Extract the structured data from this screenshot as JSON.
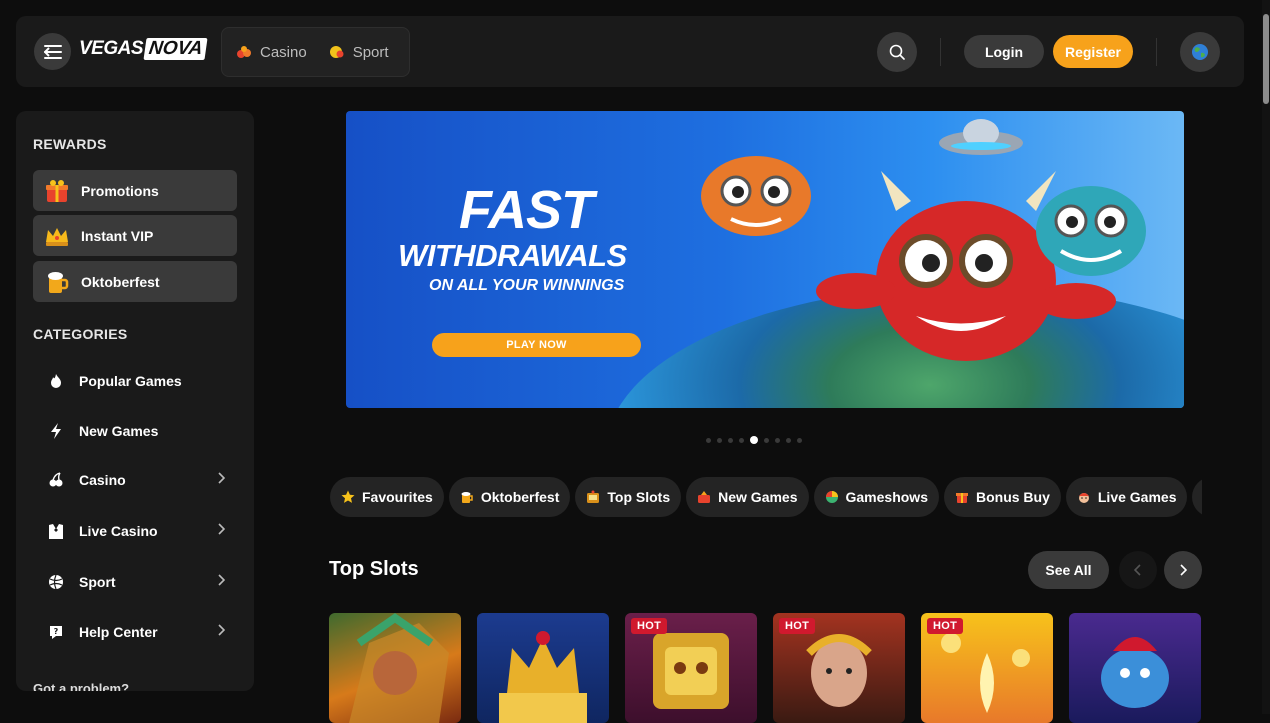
{
  "header": {
    "logo_part1": "VEGAS",
    "logo_part2": "NOVA",
    "nav": [
      {
        "label": "Casino",
        "icon": "casino-icon"
      },
      {
        "label": "Sport",
        "icon": "sport-icon"
      }
    ],
    "login_label": "Login",
    "register_label": "Register"
  },
  "sidebar": {
    "rewards_title": "REWARDS",
    "rewards": [
      {
        "label": "Promotions",
        "icon": "gift-icon"
      },
      {
        "label": "Instant VIP",
        "icon": "crown-icon"
      },
      {
        "label": "Oktoberfest",
        "icon": "beer-icon"
      }
    ],
    "categories_title": "CATEGORIES",
    "categories": [
      {
        "label": "Popular Games",
        "icon": "flame-icon",
        "chevron": false
      },
      {
        "label": "New Games",
        "icon": "lightning-icon",
        "chevron": false
      },
      {
        "label": "Casino",
        "icon": "cherry-icon",
        "chevron": true
      },
      {
        "label": "Live Casino",
        "icon": "dealer-icon",
        "chevron": true
      },
      {
        "label": "Sport",
        "icon": "ball-icon",
        "chevron": true
      },
      {
        "label": "Help Center",
        "icon": "help-icon",
        "chevron": true
      }
    ],
    "problem_text": "Got a problem?"
  },
  "banner": {
    "title": "FAST",
    "subtitle": "WITHDRAWALS",
    "tagline": "ON ALL YOUR WINNINGS",
    "cta": "PLAY NOW",
    "slide_count": 9,
    "active_slide": 5
  },
  "chips": [
    {
      "label": "Favourites",
      "icon": "star-icon"
    },
    {
      "label": "Oktoberfest",
      "icon": "beer-icon"
    },
    {
      "label": "Top Slots",
      "icon": "slot-icon"
    },
    {
      "label": "New Games",
      "icon": "new-icon"
    },
    {
      "label": "Gameshows",
      "icon": "wheel-icon"
    },
    {
      "label": "Bonus Buy",
      "icon": "bonus-icon"
    },
    {
      "label": "Live Games",
      "icon": "live-icon"
    }
  ],
  "top_slots": {
    "title": "Top Slots",
    "see_all": "See All",
    "cards": [
      {
        "hot": false,
        "badge": "",
        "theme": "aztec"
      },
      {
        "hot": false,
        "badge": "",
        "theme": "wild-crown"
      },
      {
        "hot": true,
        "badge": "HOT",
        "theme": "golden-mask"
      },
      {
        "hot": true,
        "badge": "HOT",
        "theme": "caesar"
      },
      {
        "hot": true,
        "badge": "HOT",
        "theme": "gold-coins"
      },
      {
        "hot": false,
        "badge": "",
        "theme": "genie"
      }
    ]
  },
  "colors": {
    "accent": "#f7a21b",
    "hot": "#d0192e",
    "surface": "#1a1a1a",
    "button": "#3a3a3a"
  }
}
